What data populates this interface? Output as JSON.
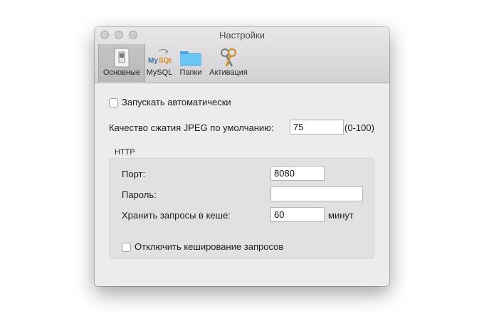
{
  "window": {
    "title": "Настройки"
  },
  "toolbar": {
    "tabs": [
      {
        "label": "Основные",
        "icon": "general-switch-icon",
        "selected": true
      },
      {
        "label": "MySQL",
        "icon": "mysql-icon",
        "selected": false
      },
      {
        "label": "Папки",
        "icon": "folder-icon",
        "selected": false
      },
      {
        "label": "Активация",
        "icon": "keys-icon",
        "selected": false
      }
    ]
  },
  "general": {
    "autostart_label": "Запускать автоматически",
    "autostart_checked": false,
    "jpeg_quality_label": "Качество сжатия JPEG по умолчанию:",
    "jpeg_quality_value": "75",
    "jpeg_quality_range": "(0-100)"
  },
  "http": {
    "group_title": "HTTP",
    "port_label": "Порт:",
    "port_value": "8080",
    "password_label": "Пароль:",
    "password_value": "",
    "cache_label": "Хранить запросы в кеше:",
    "cache_value": "60",
    "cache_unit": "минут",
    "disable_cache_label": "Отключить кеширование запросов",
    "disable_cache_checked": false
  },
  "colors": {
    "window_bg": "#ececec",
    "toolbar_bg": "#d3d1d3",
    "selected_tab_bg": "#c0bec0",
    "group_bg": "#e1e1e1",
    "folder_blue": "#5bb8ee"
  }
}
